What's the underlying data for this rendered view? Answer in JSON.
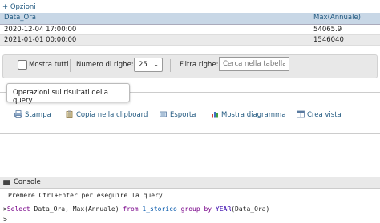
{
  "options_link": "+ Opzioni",
  "table": {
    "columns": [
      "Data_Ora",
      "Max(Annuale)"
    ],
    "rows": [
      [
        "2020-12-04 17:00:00",
        "54065.9"
      ],
      [
        "2021-01-01 00:00:00",
        "1546040"
      ]
    ]
  },
  "controls": {
    "show_all": "Mostra tutti",
    "rows_label": "Numero di righe:",
    "rows_value": "25",
    "filter_label": "Filtra righe:",
    "search_placeholder": "Cerca nella tabella"
  },
  "operations": {
    "title": "Operazioni sui risultati della query",
    "print": "Stampa",
    "copy": "Copia nella clipboard",
    "export": "Esporta",
    "chart": "Mostra diagramma",
    "view": "Crea vista"
  },
  "console": {
    "title": "Console",
    "hint": "Premere Ctrl+Enter per eseguire la query",
    "query": {
      "select": "Select",
      "cols": " Data_Ora, Max(Annuale) ",
      "from": "from",
      "table": " 1_storico ",
      "group": "group by",
      "fn": " YEAR",
      "arg": "(Data_Ora)"
    }
  },
  "colors": {
    "link": "#235a81",
    "header": "#c8d7e6"
  }
}
